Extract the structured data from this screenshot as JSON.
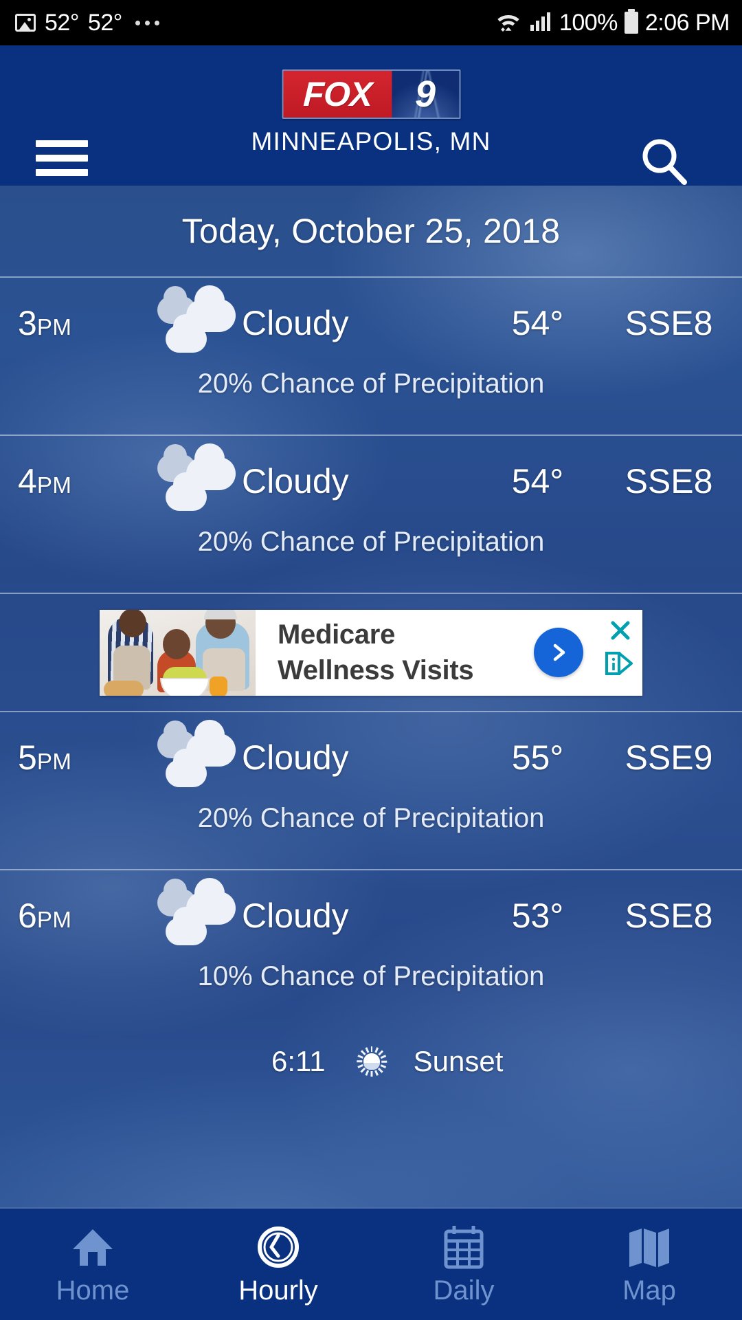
{
  "status_bar": {
    "image_icon": "photo-icon",
    "temp_1": "52°",
    "temp_2": "52°",
    "overflow": "•••",
    "wifi_icon": "wifi-icon",
    "signal_icon": "cell-signal-icon",
    "battery_percent": "100%",
    "battery_icon": "battery-full-icon",
    "clock": "2:06 PM"
  },
  "header": {
    "menu_icon": "hamburger-menu-icon",
    "logo": {
      "brand": "FOX",
      "channel": "9"
    },
    "city": "MINNEAPOLIS, MN",
    "search_icon": "search-icon",
    "background_color": "#0a3180"
  },
  "main": {
    "date_title": "Today, October 25, 2018",
    "rows": [
      {
        "time_num": "3",
        "time_ampm": "PM",
        "icon": "cloudy-icon",
        "condition": "Cloudy",
        "temperature": "54°",
        "wind": "SSE8",
        "precip": "20% Chance of Precipitation"
      },
      {
        "time_num": "4",
        "time_ampm": "PM",
        "icon": "cloudy-icon",
        "condition": "Cloudy",
        "temperature": "54°",
        "wind": "SSE8",
        "precip": "20% Chance of Precipitation"
      },
      {
        "time_num": "5",
        "time_ampm": "PM",
        "icon": "cloudy-icon",
        "condition": "Cloudy",
        "temperature": "55°",
        "wind": "SSE9",
        "precip": "20% Chance of Precipitation"
      },
      {
        "time_num": "6",
        "time_ampm": "PM",
        "icon": "cloudy-icon",
        "condition": "Cloudy",
        "temperature": "53°",
        "wind": "SSE8",
        "precip": "10% Chance of Precipitation"
      }
    ],
    "sunset": {
      "time": "6:11",
      "icon": "sunset-icon",
      "label": "Sunset"
    }
  },
  "ad": {
    "image_alt": "family-cooking-photo",
    "headline_line1": "Medicare",
    "headline_line2": "Wellness Visits",
    "cta_icon": "chevron-right-icon",
    "close_icon": "close-icon",
    "adchoices_icon": "adchoices-icon",
    "cta_color": "#1565d8",
    "marker_color": "#00a0b0"
  },
  "bottom_nav": {
    "items": [
      {
        "label": "Home",
        "icon": "home-icon",
        "active": false
      },
      {
        "label": "Hourly",
        "icon": "clock-icon",
        "active": true
      },
      {
        "label": "Daily",
        "icon": "calendar-icon",
        "active": false
      },
      {
        "label": "Map",
        "icon": "map-icon",
        "active": false
      }
    ]
  }
}
